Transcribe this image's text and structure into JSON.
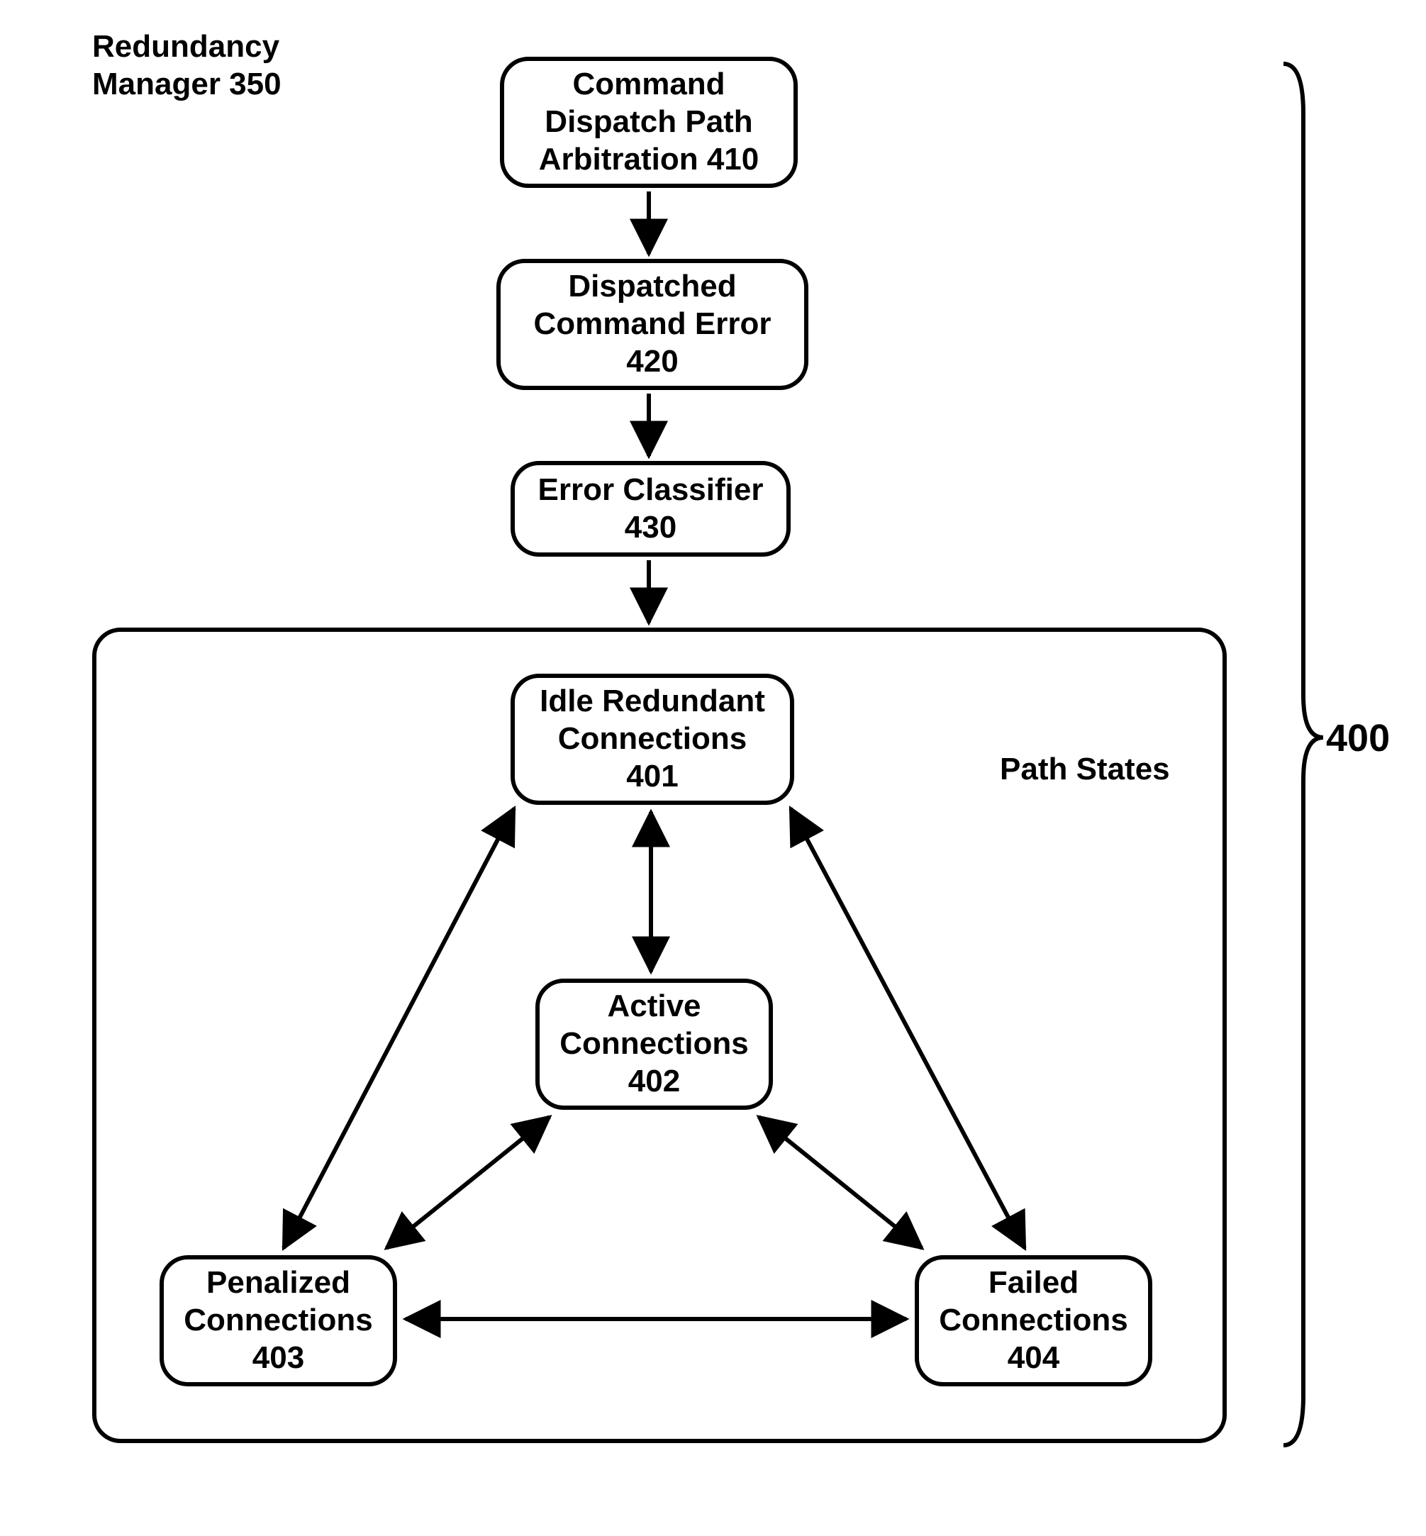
{
  "title": {
    "line1": "Redundancy",
    "line2": "Manager 350"
  },
  "nodes": {
    "n410": {
      "line1": "Command",
      "line2": "Dispatch Path",
      "line3": "Arbitration 410"
    },
    "n420": {
      "line1": "Dispatched",
      "line2": "Command Error",
      "line3": "420"
    },
    "n430": {
      "line1": "Error Classifier",
      "line2": "430"
    },
    "n401": {
      "line1": "Idle Redundant",
      "line2": "Connections",
      "line3": "401"
    },
    "n402": {
      "line1": "Active",
      "line2": "Connections",
      "line3": "402"
    },
    "n403": {
      "line1": "Penalized",
      "line2": "Connections",
      "line3": "403"
    },
    "n404": {
      "line1": "Failed",
      "line2": "Connections",
      "line3": "404"
    }
  },
  "labels": {
    "path_states": "Path States",
    "ref_400": "400"
  }
}
